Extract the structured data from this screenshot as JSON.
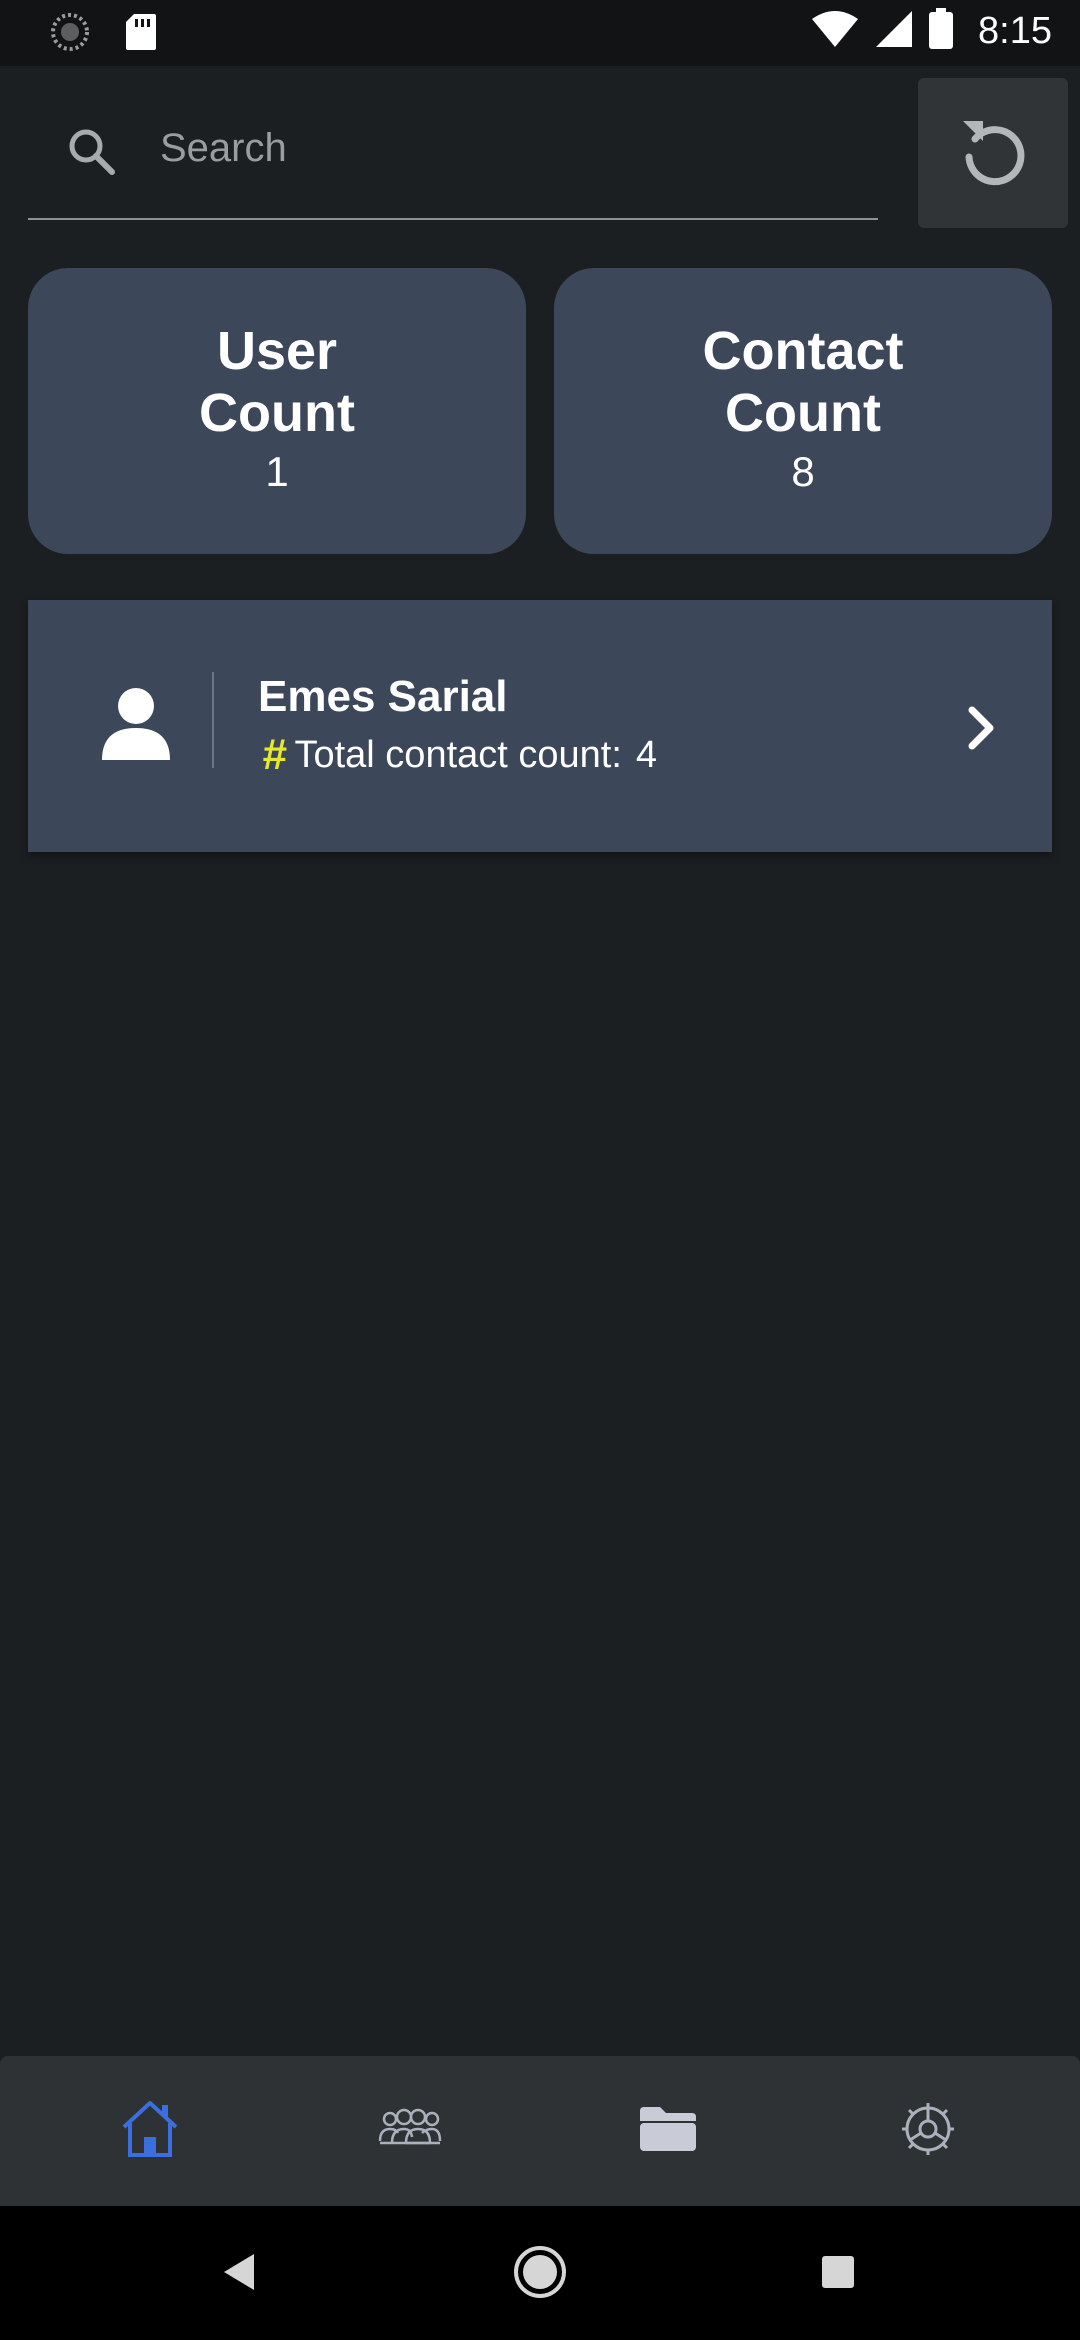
{
  "status_bar": {
    "time": "8:15",
    "left_icons": [
      "sync-icon",
      "sd-card-icon"
    ],
    "right_icons": [
      "wifi-icon",
      "cell-signal-icon",
      "battery-icon"
    ]
  },
  "search": {
    "placeholder": "Search",
    "value": ""
  },
  "stats": {
    "user_title": "User\nCount",
    "user_value": "1",
    "contact_title": "Contact\nCount",
    "contact_value": "8"
  },
  "users": [
    {
      "name": "Emes Sarial",
      "count_label": "Total contact count:",
      "count_value": "4"
    }
  ],
  "bottom_nav": {
    "active": "home",
    "items": [
      "home-icon",
      "groups-icon",
      "folder-icon",
      "settings-icon"
    ]
  },
  "colors": {
    "background": "#1c1f21",
    "card": "#3d475a",
    "accent": "#3b6fe0",
    "hash": "#e8e82b"
  }
}
